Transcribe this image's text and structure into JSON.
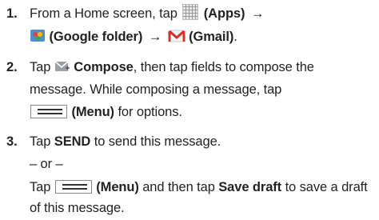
{
  "steps": [
    {
      "num": "1.",
      "l1_pre": "From a Home screen, tap",
      "l1_apps": "(Apps)",
      "arrow": "→",
      "l2_google": "(Google folder)",
      "l2_gmail": "(Gmail)",
      "period": "."
    },
    {
      "num": "2.",
      "tap": "Tap",
      "compose": "Compose",
      "l1_post": ", then tap fields to compose the",
      "l2": "message. While composing a message, tap",
      "menu": "(Menu)",
      "l3_post": "for options."
    },
    {
      "num": "3.",
      "tap": "Tap",
      "send": "SEND",
      "l1_post": "to send this message.",
      "or": "– or –",
      "tap2": "Tap",
      "menu": "(Menu)",
      "mid": "and then tap",
      "save": "Save draft",
      "l3_post": "to save a draft",
      "l4": "of this message."
    }
  ]
}
